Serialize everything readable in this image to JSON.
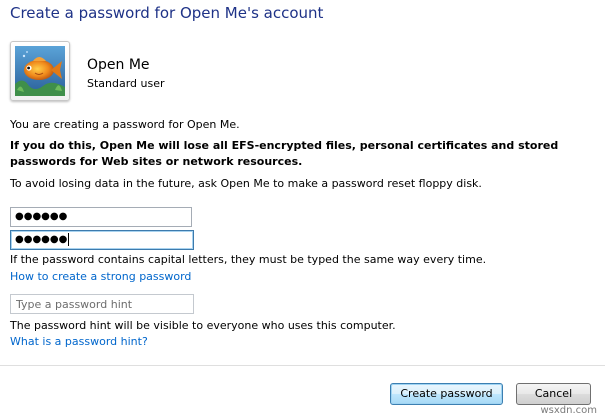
{
  "window": {
    "title": "Create a password for Open Me's account"
  },
  "user": {
    "name": "Open Me",
    "role": "Standard user",
    "avatar_icon": "fish-avatar-icon"
  },
  "messages": {
    "info": "You are creating a password for Open Me.",
    "warning": "If you do this, Open Me will lose all EFS-encrypted files, personal certificates and stored passwords for Web sites or network resources.",
    "advice": "To avoid losing data in the future, ask Open Me to make a password reset floppy disk.",
    "capital_letters": "If the password contains capital letters, they must be typed the same way every time.",
    "hint_visibility": "The password hint will be visible to everyone who uses this computer."
  },
  "fields": {
    "new_password_masked": "●●●●●●",
    "confirm_password_masked": "●●●●●●",
    "hint_placeholder": "Type a password hint",
    "hint_value": ""
  },
  "links": {
    "strong_password": "How to create a strong password",
    "what_is_hint": "What is a password hint?"
  },
  "buttons": {
    "create": "Create password",
    "cancel": "Cancel"
  },
  "watermark": "wsxdn.com",
  "colors": {
    "title": "#1e3287",
    "link": "#0066cc",
    "primary_button_border": "#3c7fb1"
  }
}
